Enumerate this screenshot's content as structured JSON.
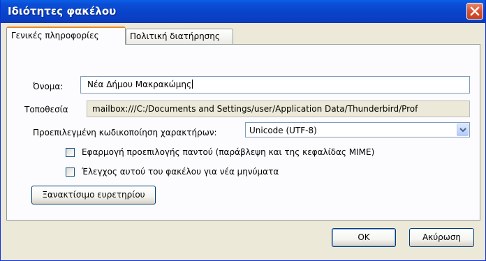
{
  "window": {
    "title": "Ιδιότητες φακέλου"
  },
  "icons": {
    "close": "close-icon",
    "dropdown": "chevron-down-icon"
  },
  "colors": {
    "titlebar": "#0845cc",
    "tab_highlight": "#e68b2c",
    "dialog_bg": "#ece9d8"
  },
  "tabs": [
    {
      "label": "Γενικές πληροφορίες",
      "selected": true
    },
    {
      "label": "Πολιτική διατήρησης",
      "selected": false
    }
  ],
  "general": {
    "name_label": "Όνομα:",
    "name_value": "Νέα Δήμου Μακρακώμης",
    "location_label": "Τοποθεσία",
    "location_value": "mailbox:///C:/Documents and Settings/user/Application Data/Thunderbird/Prof",
    "encoding_label": "Προεπιλεγμένη κωδικοποίηση χαρακτήρων:",
    "encoding_value": "Unicode (UTF-8)",
    "apply_default_label": "Εφαρμογή προεπιλογής παντού (παράβλεψη και της κεφαλίδας MIME)",
    "apply_default_checked": false,
    "check_new_label": "Έλεγχος αυτού του φακέλου για νέα μηνύματα",
    "check_new_checked": false,
    "rebuild_label": "Ξανακτίσιμο ευρετηρίου"
  },
  "buttons": {
    "ok": "OK",
    "cancel": "Ακύρωση"
  }
}
